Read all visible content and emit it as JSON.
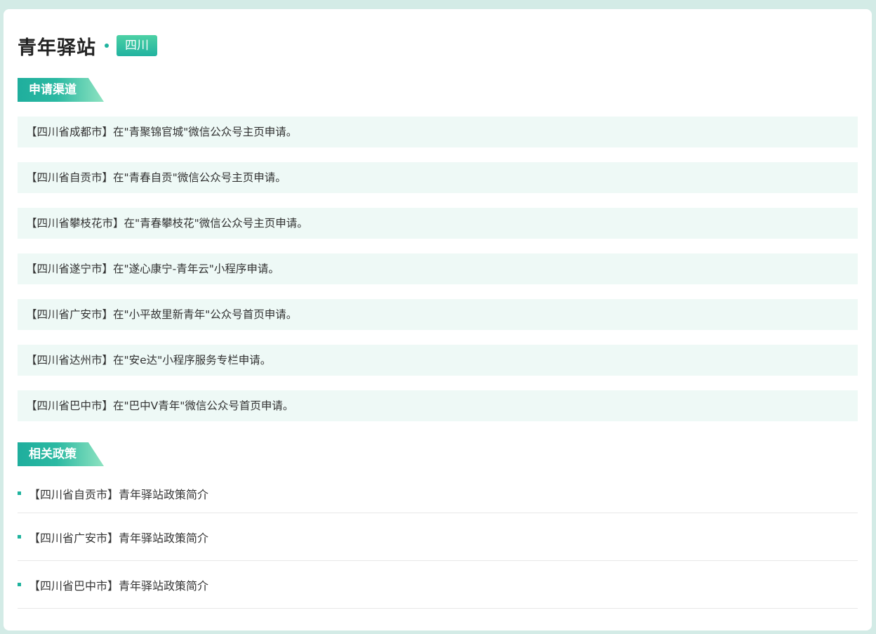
{
  "header": {
    "title": "青年驿站",
    "region": "四川"
  },
  "sections": {
    "channels_title": "申请渠道",
    "policies_title": "相关政策"
  },
  "channels": [
    "【四川省成都市】在\"青聚锦官城\"微信公众号主页申请。",
    "【四川省自贡市】在\"青春自贡\"微信公众号主页申请。",
    "【四川省攀枝花市】在\"青春攀枝花\"微信公众号主页申请。",
    "【四川省遂宁市】在\"遂心康宁-青年云\"小程序申请。",
    "【四川省广安市】在\"小平故里新青年\"公众号首页申请。",
    "【四川省达州市】在\"安e达\"小程序服务专栏申请。",
    "【四川省巴中市】在\"巴中V青年\"微信公众号首页申请。"
  ],
  "policies": [
    "【四川省自贡市】青年驿站政策简介",
    "【四川省广安市】青年驿站政策简介",
    "【四川省巴中市】青年驿站政策简介"
  ],
  "colors": {
    "accent": "#1fb39e",
    "channel_bg": "#eef9f6",
    "page_bg": "#d3ebe6"
  }
}
